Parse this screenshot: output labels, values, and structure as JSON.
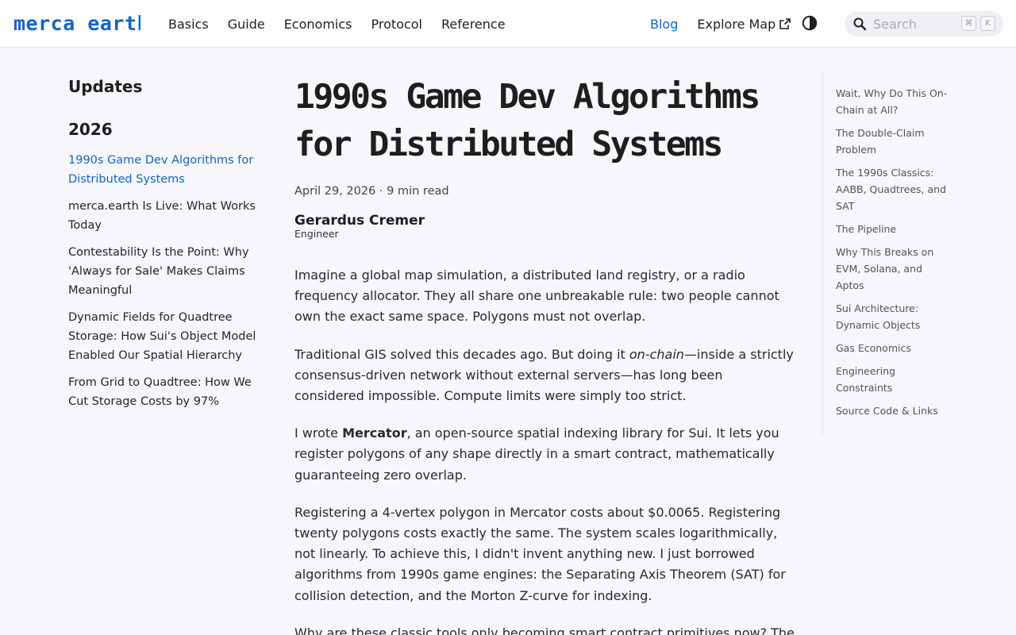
{
  "header": {
    "logo": "merca earth",
    "nav_left": [
      "Basics",
      "Guide",
      "Economics",
      "Protocol",
      "Reference"
    ],
    "nav_right": {
      "blog": "Blog",
      "explore_map": "Explore Map"
    },
    "search": {
      "placeholder": "Search",
      "kbd_cmd": "⌘",
      "kbd_k": "K"
    },
    "accent_color": "#1565c0"
  },
  "sidebar": {
    "title": "Updates",
    "year": "2026",
    "items": [
      "1990s Game Dev Algorithms for Distributed Systems",
      "merca.earth Is Live: What Works Today",
      "Contestability Is the Point: Why 'Always for Sale' Makes Claims Meaningful",
      "Dynamic Fields for Quadtree Storage: How Sui's Object Model Enabled Our Spatial Hierarchy",
      "From Grid to Quadtree: How We Cut Storage Costs by 97%"
    ]
  },
  "article": {
    "title": "1990s Game Dev Algorithms for Distributed Systems",
    "meta": "April 29, 2026 · 9 min read",
    "author_name": "Gerardus Cremer",
    "author_role": "Engineer",
    "p1": "Imagine a global map simulation, a distributed land registry, or a radio frequency allocator. They all share one unbreakable rule: two people cannot own the exact same space. Polygons must not overlap.",
    "p2_a": "Traditional GIS solved this decades ago. But doing it ",
    "p2_em": "on-chain",
    "p2_b": "—inside a strictly consensus-driven network without external servers—has long been considered impossible. Compute limits were simply too strict.",
    "p3_a": "I wrote ",
    "p3_strong": "Mercator",
    "p3_b": ", an open-source spatial indexing library for Sui. It lets you register polygons of any shape directly in a smart contract, mathematically guaranteeing zero overlap.",
    "p4": "Registering a 4-vertex polygon in Mercator costs about $0.0065. Registering twenty polygons costs exactly the same. The system scales logarithmically, not linearly. To achieve this, I didn't invent anything new. I just borrowed algorithms from 1990s game engines: the Separating Axis Theorem (SAT) for collision detection, and the Morton Z-curve for indexing.",
    "p5": "Why are these classic tools only becoming smart contract primitives now? The"
  },
  "toc": [
    "Wait, Why Do This On-Chain at All?",
    "The Double-Claim Problem",
    "The 1990s Classics: AABB, Quadtrees, and SAT",
    "The Pipeline",
    "Why This Breaks on EVM, Solana, and Aptos",
    "Sui Architecture: Dynamic Objects",
    "Gas Economics",
    "Engineering Constraints",
    "Source Code & Links"
  ]
}
